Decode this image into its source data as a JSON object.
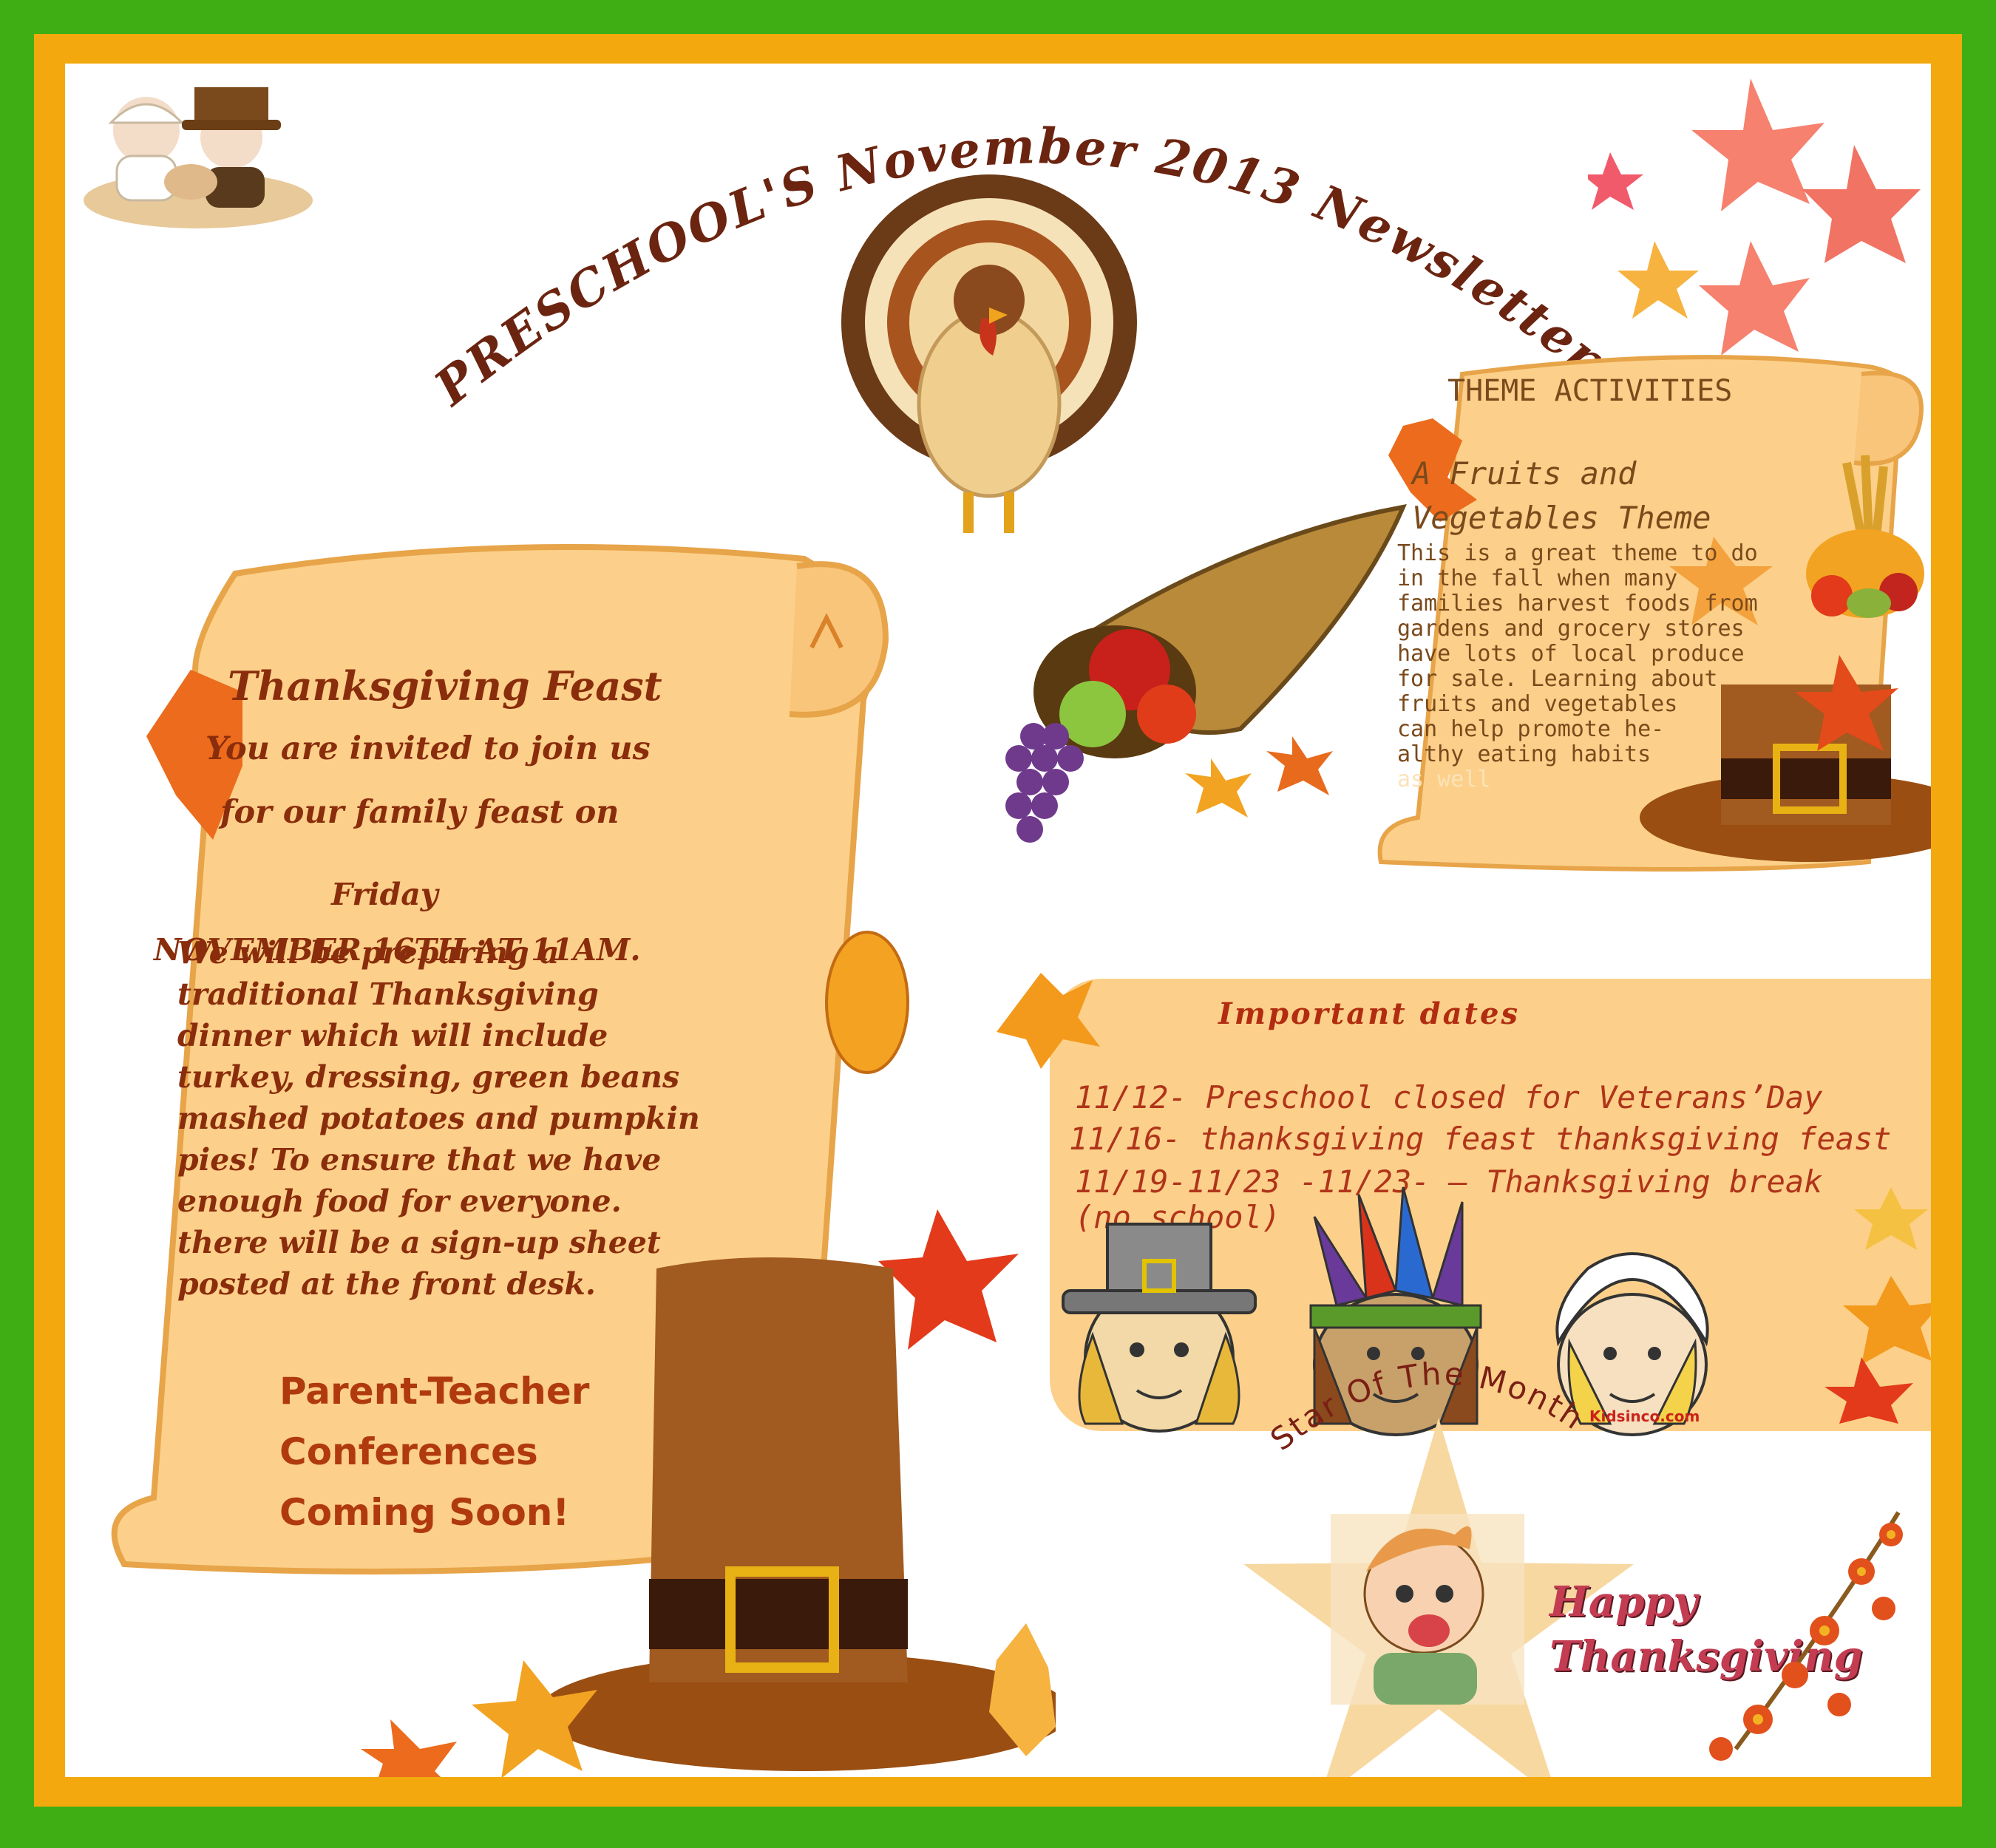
{
  "title": "PRESCHOOL'S November 2013 Newsletter",
  "feast": {
    "heading": "Thanksgiving Feast",
    "invite_line1": "You are invited to join us",
    "invite_line2": "for our family feast on",
    "day": "Friday",
    "date_time": "NOVEMBER 16TH AT 11AM.",
    "body_lines": [
      "We will be preparing a",
      "traditional Thanksgiving",
      "dinner which will include",
      "turkey, dressing, green beans",
      "mashed potatoes and pumpkin",
      "pies! To ensure that we have",
      "enough food for everyone.",
      "there will be a sign-up sheet",
      "posted at the front desk."
    ],
    "ptc_lines": [
      "Parent-Teacher",
      "Conferences",
      "Coming Soon!"
    ]
  },
  "theme": {
    "heading": "THEME ACTIVITIES",
    "subtitle_line1": "A Fruits and",
    "subtitle_line2": "Vegetables Theme",
    "body_lines": [
      "This is a great theme to do",
      "in the fall when many",
      "families harvest foods from",
      "gardens and grocery stores",
      "have lots of local produce",
      "for sale. Learning about",
      "fruits and vegetables",
      "can help promote he-",
      "althy eating habits",
      "as well"
    ]
  },
  "dates": {
    "heading": "Important  dates",
    "lines": [
      "11/12- Preschool closed for Veterans’Day",
      "11/16- thanksgiving feast thanksgiving feast",
      "11/19-11/23 -11/23- — Thanksgiving break",
      "(no school)"
    ],
    "credit": "Kidsinco.com"
  },
  "star": {
    "heading": "Star Of The Month"
  },
  "greeting": {
    "line1": "Happy",
    "line2": "Thanksgiving"
  },
  "colors": {
    "outer_border": "#3fae15",
    "inner_border": "#f3a90e",
    "parchment": "#fcd08a",
    "title_brown": "#6b2410",
    "text_rust": "#8a2d0c"
  },
  "icons": [
    "pilgrim-children-image",
    "turkey-image",
    "falling-leaves-image",
    "cornucopia-image",
    "harvest-basket-image",
    "pilgrim-hat-image",
    "kids-costume-image",
    "star-child-image",
    "autumn-flowers-image"
  ]
}
